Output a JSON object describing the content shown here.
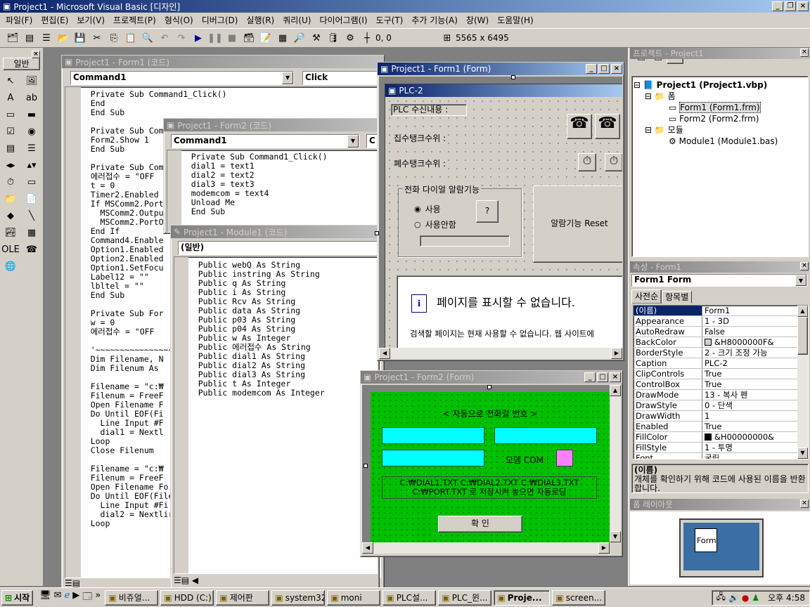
{
  "app_title": "Project1 - Microsoft Visual Basic [디자인]",
  "menu": [
    "파일(F)",
    "편집(E)",
    "보기(V)",
    "프로젝트(P)",
    "형식(O)",
    "디버그(D)",
    "실행(R)",
    "쿼리(U)",
    "다이어그램(I)",
    "도구(T)",
    "추가 기능(A)",
    "창(W)",
    "도움말(H)"
  ],
  "toolbar": {
    "pos": "0, 0",
    "size": "5565 x 6495"
  },
  "toolbox": {
    "tab": "일반"
  },
  "code_form1": {
    "title": "Project1 - Form1 (코드)",
    "object": "Command1",
    "proc": "Click",
    "lines": [
      "    Private Sub Command1_Click()",
      "    End",
      "    End Sub",
      "",
      "    Private Sub Com",
      "    Form2.Show 1",
      "    End Sub",
      "",
      "    Private Sub Com",
      "    에러접수 = \"OFF",
      "    t = 0",
      "    Timer2.Enabled",
      "    If MSComm2.Port",
      "      MSComm2.Outpu",
      "      MSComm2.PortO",
      "    End If",
      "    Command4.Enable",
      "    Option1.Enabled",
      "    Option2.Enabled",
      "    Option1.SetFocu",
      "    Label12 = \"\"",
      "    lbltel = \"\"",
      "    End Sub",
      "",
      "    Private Sub For",
      "    w = 0",
      "    에러접수 = \"OFF",
      "",
      "    '~~~~~~~~~~~~~~~~",
      "    Dim Filename, N",
      "    Dim Filenum As",
      "",
      "    Filename = \"c:₩",
      "    Filenum = FreeF",
      "    Open Filename F",
      "    Do Until EOF(Fi",
      "      Line Input #F",
      "      dial1 = Nextl",
      "    Loop",
      "    Close Filenum",
      "",
      "    Filename = \"c:₩",
      "    Filenum = FreeF",
      "    Open Filename Fo",
      "    Do Until EOF(File",
      "      Line Input #Fi",
      "      dial2 = Nextlir",
      "    Loop"
    ]
  },
  "code_form2": {
    "title": "Project1 - Form2 (코드)",
    "object": "Command1",
    "proc": "C",
    "lines": [
      "    Private Sub Command1_Click()",
      "    dial1 = text1",
      "    dial2 = text2",
      "    dial3 = text3",
      "    modemcom = text4",
      "    Unload Me",
      "    End Sub"
    ]
  },
  "code_module1": {
    "title": "Project1 - Module1 (코드)",
    "object": "(일반)",
    "lines": [
      "    Public webQ As String",
      "    Public instring As String",
      "    Public q As String",
      "    Public i As String",
      "    Public Rcv As String",
      "    Public data As String",
      "    Public p03 As String",
      "    Public p04 As String",
      "    Public w As Integer",
      "    Public 에러접수 As String",
      "    Public dial1 As String",
      "    Public dial2 As String",
      "    Public dial3 As String",
      "    Public t As Integer",
      "    Public modemcom As Integer"
    ]
  },
  "form1": {
    "title": "Project1 - Form1 (Form)",
    "caption": "PLC-2",
    "lbl_recv": "PLC 수신내용 :",
    "lbl_tank1": "집수탱크수위 :",
    "lbl_tank2": "폐수탱크수위 :",
    "frame": "전화 다이얼 알람기능",
    "opt_use": "사용",
    "opt_nouse": "사용안함",
    "btn_q": "?",
    "btn_reset": "알람기능 Reset",
    "web_msg": "페이지를 표시할 수 없습니다.",
    "web_sub": "검색할 페이지는 현재 사용할 수 없습니다. 웹 사이트에"
  },
  "form2": {
    "title": "Project1 - Form2 (Form)",
    "heading": "< 자동으로 전화걸 번호 >",
    "modem_label": "모뎀 COM :",
    "note": "C:₩DIAL1.TXT C:₩DIAL2.TXT C:₩DIAL3.TXT C:₩PORT.TXT 로 저장시켜 놓으면 자동로딩",
    "ok": "확  인"
  },
  "project": {
    "title": "프로젝트 - Project1",
    "root": "Project1 (Project1.vbp)",
    "forms_folder": "폼",
    "form1": "Form1 (Form1.frm)",
    "form2": "Form2 (Form2.frm)",
    "modules_folder": "모듈",
    "module1": "Module1 (Module1.bas)"
  },
  "properties": {
    "title": "속성 - Form1",
    "object": "Form1 Form",
    "tab1": "사전순",
    "tab2": "항목별",
    "rows": [
      [
        "(이름)",
        "Form1"
      ],
      [
        "Appearance",
        "1 - 3D"
      ],
      [
        "AutoRedraw",
        "False"
      ],
      [
        "BackColor",
        "&H8000000F&"
      ],
      [
        "BorderStyle",
        "2 - 크기 조정 가능"
      ],
      [
        "Caption",
        "PLC-2"
      ],
      [
        "ClipControls",
        "True"
      ],
      [
        "ControlBox",
        "True"
      ],
      [
        "DrawMode",
        "13 - 복사 펜"
      ],
      [
        "DrawStyle",
        "0 - 단색"
      ],
      [
        "DrawWidth",
        "1"
      ],
      [
        "Enabled",
        "True"
      ],
      [
        "FillColor",
        "&H00000000&"
      ],
      [
        "FillStyle",
        "1 - 투명"
      ],
      [
        "Font",
        "굴림"
      ]
    ],
    "desc_title": "(이름)",
    "desc": "개체를 확인하기 위해 코드에 사용된 이름을 반환합니다."
  },
  "layout_win": {
    "title": "폼 레이아웃",
    "form_label": "Form"
  },
  "taskbar": {
    "start": "시작",
    "items": [
      "비쥬얼...",
      "HDD (C:)",
      "제어판",
      "system32",
      "moni",
      "PLC설...",
      "PLC_윈...",
      "Proje...",
      "screen..."
    ],
    "clock": "오후 4:58"
  }
}
